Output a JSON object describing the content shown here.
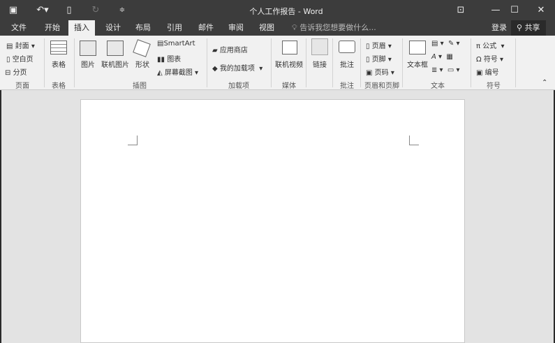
{
  "title": "个人工作报告 - Word",
  "qat": {
    "save": "save-icon",
    "undo": "undo-icon",
    "new": "new-doc-icon",
    "redo": "redo-icon",
    "customize": "customize-icon"
  },
  "tabs": [
    "文件",
    "开始",
    "插入",
    "设计",
    "布局",
    "引用",
    "邮件",
    "审阅",
    "视图"
  ],
  "tell_me": "告诉我您想要做什么...",
  "signin": "登录",
  "share": "共享",
  "groups": {
    "page": {
      "label": "页面",
      "items": [
        "封面",
        "空白页",
        "分页"
      ]
    },
    "table": {
      "label": "表格",
      "items": [
        "表格"
      ]
    },
    "illustrations": {
      "label": "插图",
      "items": [
        "图片",
        "联机图片",
        "形状",
        "SmartArt",
        "图表",
        "屏幕截图"
      ]
    },
    "addins": {
      "label": "加载项",
      "items": [
        "应用商店",
        "我的加载项"
      ]
    },
    "media": {
      "label": "媒体",
      "items": [
        "联机视频"
      ]
    },
    "links": {
      "label": "",
      "items": [
        "链接"
      ]
    },
    "comments": {
      "label": "批注",
      "items": [
        "批注"
      ]
    },
    "headerfooter": {
      "label": "页眉和页脚",
      "items": [
        "页眉",
        "页脚",
        "页码"
      ]
    },
    "text": {
      "label": "文本",
      "items": [
        "文本框"
      ]
    },
    "symbols": {
      "label": "符号",
      "items": [
        "公式",
        "符号",
        "编号"
      ]
    }
  }
}
